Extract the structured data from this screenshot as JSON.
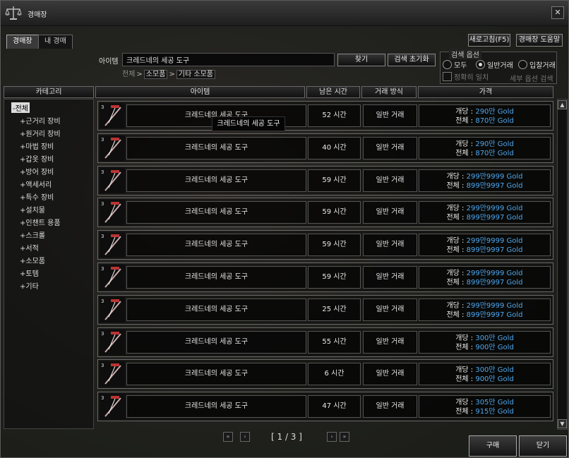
{
  "window": {
    "title": "경매장",
    "close_glyph": "✕"
  },
  "tabs": [
    {
      "label": "경매장"
    },
    {
      "label": "내 경매"
    }
  ],
  "top_buttons": {
    "refresh": "새로고침(F5)",
    "help": "경매장 도움말"
  },
  "search": {
    "label": "아이템",
    "value": "크레드네의 세공 도구",
    "find_button": "찾기",
    "reset_button": "검색 초기화",
    "breadcrumb": [
      "전체",
      "소모품",
      "기타 소모품"
    ]
  },
  "options": {
    "title": "검색 옵션",
    "radios": [
      {
        "label": "모두",
        "selected": false
      },
      {
        "label": "일반거래",
        "selected": true
      },
      {
        "label": "입찰거래",
        "selected": false
      }
    ],
    "exact_match": "정확히 일치",
    "detail_search": "세부 옵션 검색"
  },
  "headers": {
    "category": "카테고리",
    "item": "아이템",
    "time": "남은 시간",
    "type": "거래 방식",
    "price": "가격"
  },
  "categories": [
    {
      "label": "-전체",
      "selected": true
    },
    {
      "label": "+근거리 장비"
    },
    {
      "label": "+원거리 장비"
    },
    {
      "label": "+마법 장비"
    },
    {
      "label": "+갑옷 장비"
    },
    {
      "label": "+방어 장비"
    },
    {
      "label": "+액세서리"
    },
    {
      "label": "+특수 장비"
    },
    {
      "label": "+설치물"
    },
    {
      "label": "+인챈트 용품"
    },
    {
      "label": "+스크롤"
    },
    {
      "label": "+서적"
    },
    {
      "label": "+소모품"
    },
    {
      "label": "+토템"
    },
    {
      "label": "+기타"
    }
  ],
  "listings": [
    {
      "qty": "3",
      "name": "크레드네의 세공 도구",
      "time": "52 시간",
      "type": "일반 거래",
      "unit_label": "개당 : ",
      "unit": "290만 Gold",
      "total_label": "전체 : ",
      "total": "870만 Gold"
    },
    {
      "qty": "3",
      "name": "크레드네의 세공 도구",
      "time": "40 시간",
      "type": "일반 거래",
      "unit_label": "개당 : ",
      "unit": "290만 Gold",
      "total_label": "전체 : ",
      "total": "870만 Gold"
    },
    {
      "qty": "3",
      "name": "크레드네의 세공 도구",
      "time": "59 시간",
      "type": "일반 거래",
      "unit_label": "개당 : ",
      "unit": "299만9999 Gold",
      "total_label": "전체 : ",
      "total": "899만9997 Gold"
    },
    {
      "qty": "3",
      "name": "크레드네의 세공 도구",
      "time": "59 시간",
      "type": "일반 거래",
      "unit_label": "개당 : ",
      "unit": "299만9999 Gold",
      "total_label": "전체 : ",
      "total": "899만9997 Gold"
    },
    {
      "qty": "3",
      "name": "크레드네의 세공 도구",
      "time": "59 시간",
      "type": "일반 거래",
      "unit_label": "개당 : ",
      "unit": "299만9999 Gold",
      "total_label": "전체 : ",
      "total": "899만9997 Gold"
    },
    {
      "qty": "3",
      "name": "크레드네의 세공 도구",
      "time": "59 시간",
      "type": "일반 거래",
      "unit_label": "개당 : ",
      "unit": "299만9999 Gold",
      "total_label": "전체 : ",
      "total": "899만9997 Gold"
    },
    {
      "qty": "3",
      "name": "크레드네의 세공 도구",
      "time": "25 시간",
      "type": "일반 거래",
      "unit_label": "개당 : ",
      "unit": "299만9999 Gold",
      "total_label": "전체 : ",
      "total": "899만9997 Gold"
    },
    {
      "qty": "3",
      "name": "크레드네의 세공 도구",
      "time": "55 시간",
      "type": "일반 거래",
      "unit_label": "개당 : ",
      "unit": "300만 Gold",
      "total_label": "전체 : ",
      "total": "900만 Gold"
    },
    {
      "qty": "3",
      "name": "크레드네의 세공 도구",
      "time": "6 시간",
      "type": "일반 거래",
      "unit_label": "개당 : ",
      "unit": "300만 Gold",
      "total_label": "전체 : ",
      "total": "900만 Gold"
    },
    {
      "qty": "3",
      "name": "크레드네의 세공 도구",
      "time": "47 시간",
      "type": "일반 거래",
      "unit_label": "개당 : ",
      "unit": "305만 Gold",
      "total_label": "전체 : ",
      "total": "915만 Gold"
    }
  ],
  "tooltip": "크레드네의 세공 도구",
  "pagination": {
    "text": "[ 1 / 3 ]",
    "first": "«",
    "prev": "‹",
    "next": "›",
    "last": "»"
  },
  "bottom_buttons": {
    "buy": "구매",
    "close": "닫기"
  },
  "scroll": {
    "up": "▲",
    "down": "▼"
  },
  "colors": {
    "price_value": "#4fa7ee",
    "background": "#1d1f1c"
  }
}
